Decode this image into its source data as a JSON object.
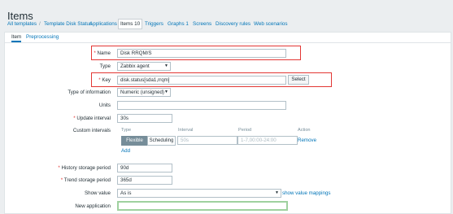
{
  "page": {
    "title": "Items"
  },
  "breadcrumbs": {
    "all_templates": "All templates",
    "separator": "/",
    "template": "Template Disk Status",
    "applications": "Applications",
    "items": "Items 10",
    "triggers": "Triggers",
    "graphs": "Graphs 1",
    "screens": "Screens",
    "discovery": "Discovery rules",
    "web": "Web scenarios"
  },
  "form_tabs": {
    "item": "Item",
    "preprocessing": "Preprocessing"
  },
  "form": {
    "name_label": "Name",
    "name_value": "Disk RRQM/S",
    "type_label": "Type",
    "type_value": "Zabbix agent",
    "key_label": "Key",
    "key_value": "disk.status[sda1,rrqm]",
    "select_button": "Select",
    "type_of_info_label": "Type of information",
    "type_of_info_value": "Numeric (unsigned)",
    "units_label": "Units",
    "units_value": "",
    "update_interval_label": "Update interval",
    "update_interval_value": "30s",
    "custom_intervals_label": "Custom intervals",
    "ci_headers": {
      "type": "Type",
      "interval": "Interval",
      "period": "Period",
      "action": "Action"
    },
    "ci_row": {
      "flexible": "Flexible",
      "scheduling": "Scheduling",
      "interval_placeholder": "50s",
      "period_placeholder": "1-7,00:00-24:00",
      "remove": "Remove"
    },
    "add_link": "Add",
    "history_label": "History storage period",
    "history_value": "90d",
    "trend_label": "Trend storage period",
    "trend_value": "365d",
    "show_value_label": "Show value",
    "show_value_value": "As is",
    "show_value_mappings": "show value mappings",
    "new_application_label": "New application",
    "new_application_value": ""
  },
  "colors": {
    "accent": "#0275b8",
    "required": "#e33734",
    "highlight_box": "#e33734",
    "focus_border": "#9fd19f"
  }
}
